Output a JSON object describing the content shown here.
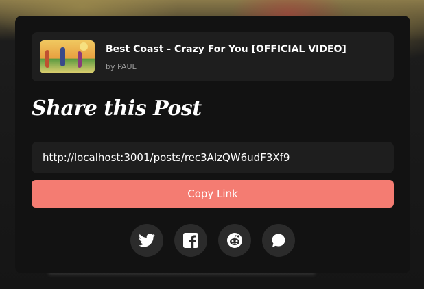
{
  "video": {
    "title": "Best Coast - Crazy For You [OFFICIAL VIDEO]",
    "author": "by PAUL"
  },
  "heading": "Share this Post",
  "share_link": {
    "value": "http://localhost:3001/posts/rec3AlzQW6udF3Xf9"
  },
  "copy_button": {
    "label": "Copy Link",
    "color": "#f47c72"
  },
  "share_buttons": [
    {
      "icon": "twitter-icon"
    },
    {
      "icon": "facebook-icon"
    },
    {
      "icon": "reddit-icon"
    },
    {
      "icon": "chat-bubble-icon"
    }
  ]
}
